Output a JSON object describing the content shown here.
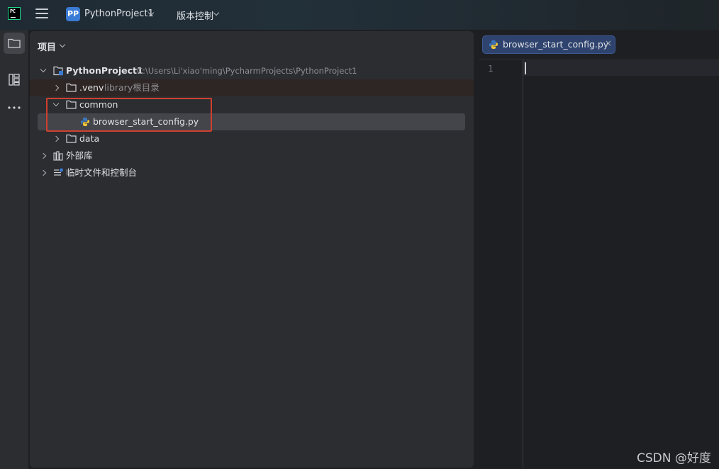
{
  "titlebar": {
    "app_logo_text": "PC",
    "project_badge": "PP",
    "project_name": "PythonProject1",
    "vcs_label": "版本控制"
  },
  "toolstrip": {
    "items": [
      "folder-icon",
      "structure-icon",
      "more-icon"
    ]
  },
  "project_panel": {
    "title": "项目",
    "tree": [
      {
        "label": "PythonProject1",
        "hint": "C:\\Users\\Li'xiao'ming\\PycharmProjects\\PythonProject1",
        "expanded": true
      },
      {
        "label": ".venv",
        "hint": "library根目录",
        "expanded": false
      },
      {
        "label": "common",
        "expanded": true
      },
      {
        "label": "browser_start_config.py",
        "selected": true
      },
      {
        "label": "data",
        "expanded": false
      },
      {
        "label": "外部库",
        "expanded": false
      },
      {
        "label": "临时文件和控制台",
        "expanded": false
      }
    ]
  },
  "editor": {
    "tab_label": "browser_start_config.py",
    "tab_close": "×",
    "line_number": "1"
  },
  "watermark": "CSDN @好度",
  "colors": {
    "background": "#1e1f22",
    "panel": "#2b2d30",
    "selection": "#43454a",
    "highlight_box": "#d0402f",
    "tab_active": "#2e436e",
    "project_badge": "#3a7bd5"
  }
}
